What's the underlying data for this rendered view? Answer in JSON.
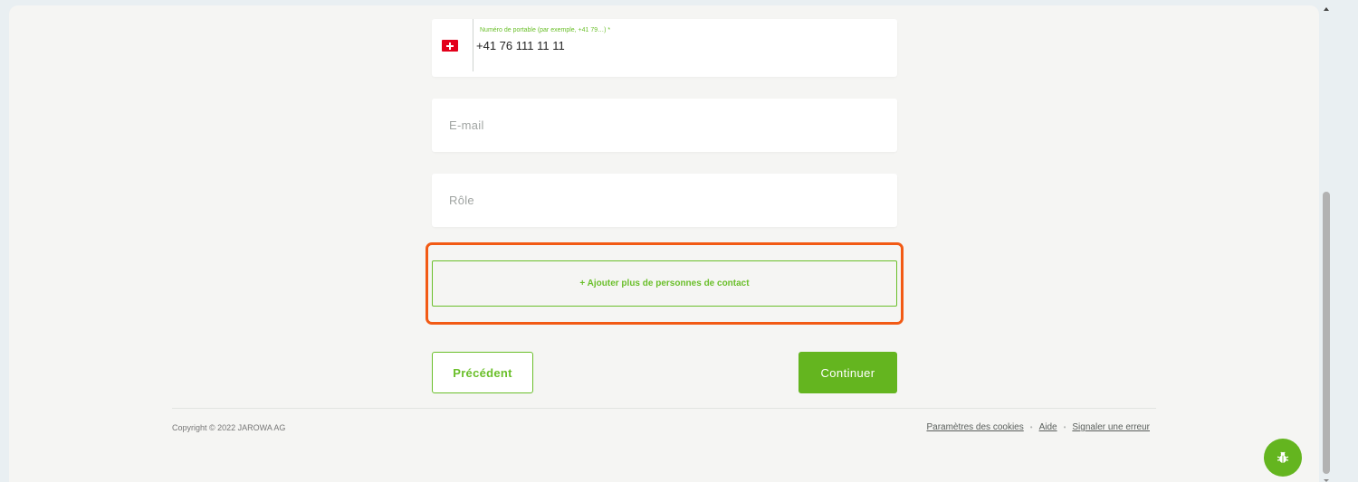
{
  "form": {
    "phone": {
      "label": "Numéro de portable (par exemple, +41 79…) *",
      "value": "+41 76 111 11 11",
      "country_flag": "switzerland-flag-icon"
    },
    "email": {
      "placeholder": "E-mail"
    },
    "role": {
      "placeholder": "Rôle"
    },
    "add_contact_label": "+ Ajouter plus de personnes de contact"
  },
  "navigation": {
    "previous_label": "Précédent",
    "continue_label": "Continuer"
  },
  "footer": {
    "copyright": "Copyright © 2022 JAROWA AG",
    "links": [
      "Paramètres des cookies",
      "Aide",
      "Signaler une erreur"
    ],
    "separator": "•"
  },
  "colors": {
    "accent": "#64b51f",
    "highlight": "#f25a14",
    "background": "#f5f5f3"
  },
  "icons": {
    "bug_report": "bug-icon"
  }
}
